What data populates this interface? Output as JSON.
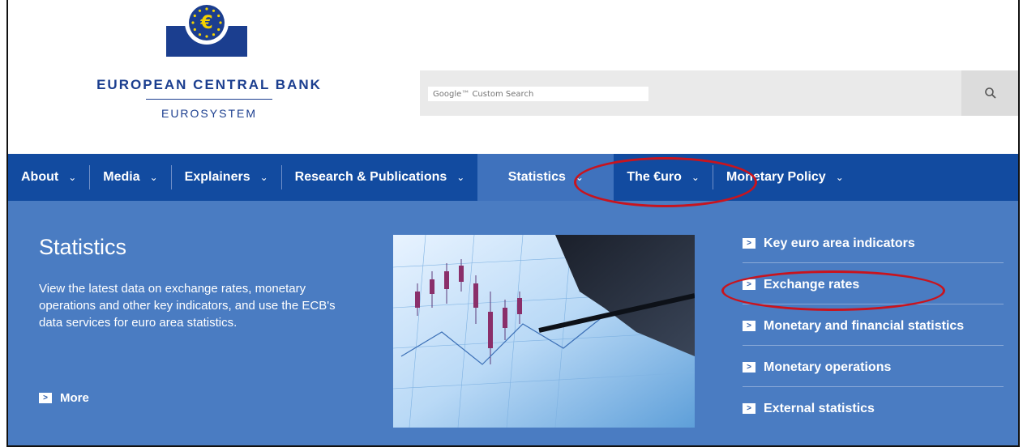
{
  "header": {
    "bank_name": "EUROPEAN CENTRAL BANK",
    "subtitle": "EUROSYSTEM",
    "search": {
      "placeholder": "Google™ Custom Search"
    }
  },
  "nav": {
    "items": [
      {
        "label": "About"
      },
      {
        "label": "Media"
      },
      {
        "label": "Explainers"
      },
      {
        "label": "Research & Publications"
      },
      {
        "label": "Statistics",
        "active": true
      },
      {
        "label": "The €uro"
      },
      {
        "label": "Monetary Policy"
      }
    ]
  },
  "panel": {
    "title": "Statistics",
    "description": "View the latest data on exchange rates, monetary operations and other key indicators, and use the ECB's data services for euro area statistics.",
    "more_label": "More",
    "links": [
      {
        "label": "Key euro area indicators"
      },
      {
        "label": "Exchange rates"
      },
      {
        "label": "Monetary and financial statistics"
      },
      {
        "label": "Monetary operations"
      },
      {
        "label": "External statistics"
      }
    ]
  },
  "colors": {
    "brand_blue": "#1b3e8f",
    "nav_bg": "#124ba0",
    "panel_bg": "#4a7cc2",
    "annotation_red": "#c8141e"
  }
}
